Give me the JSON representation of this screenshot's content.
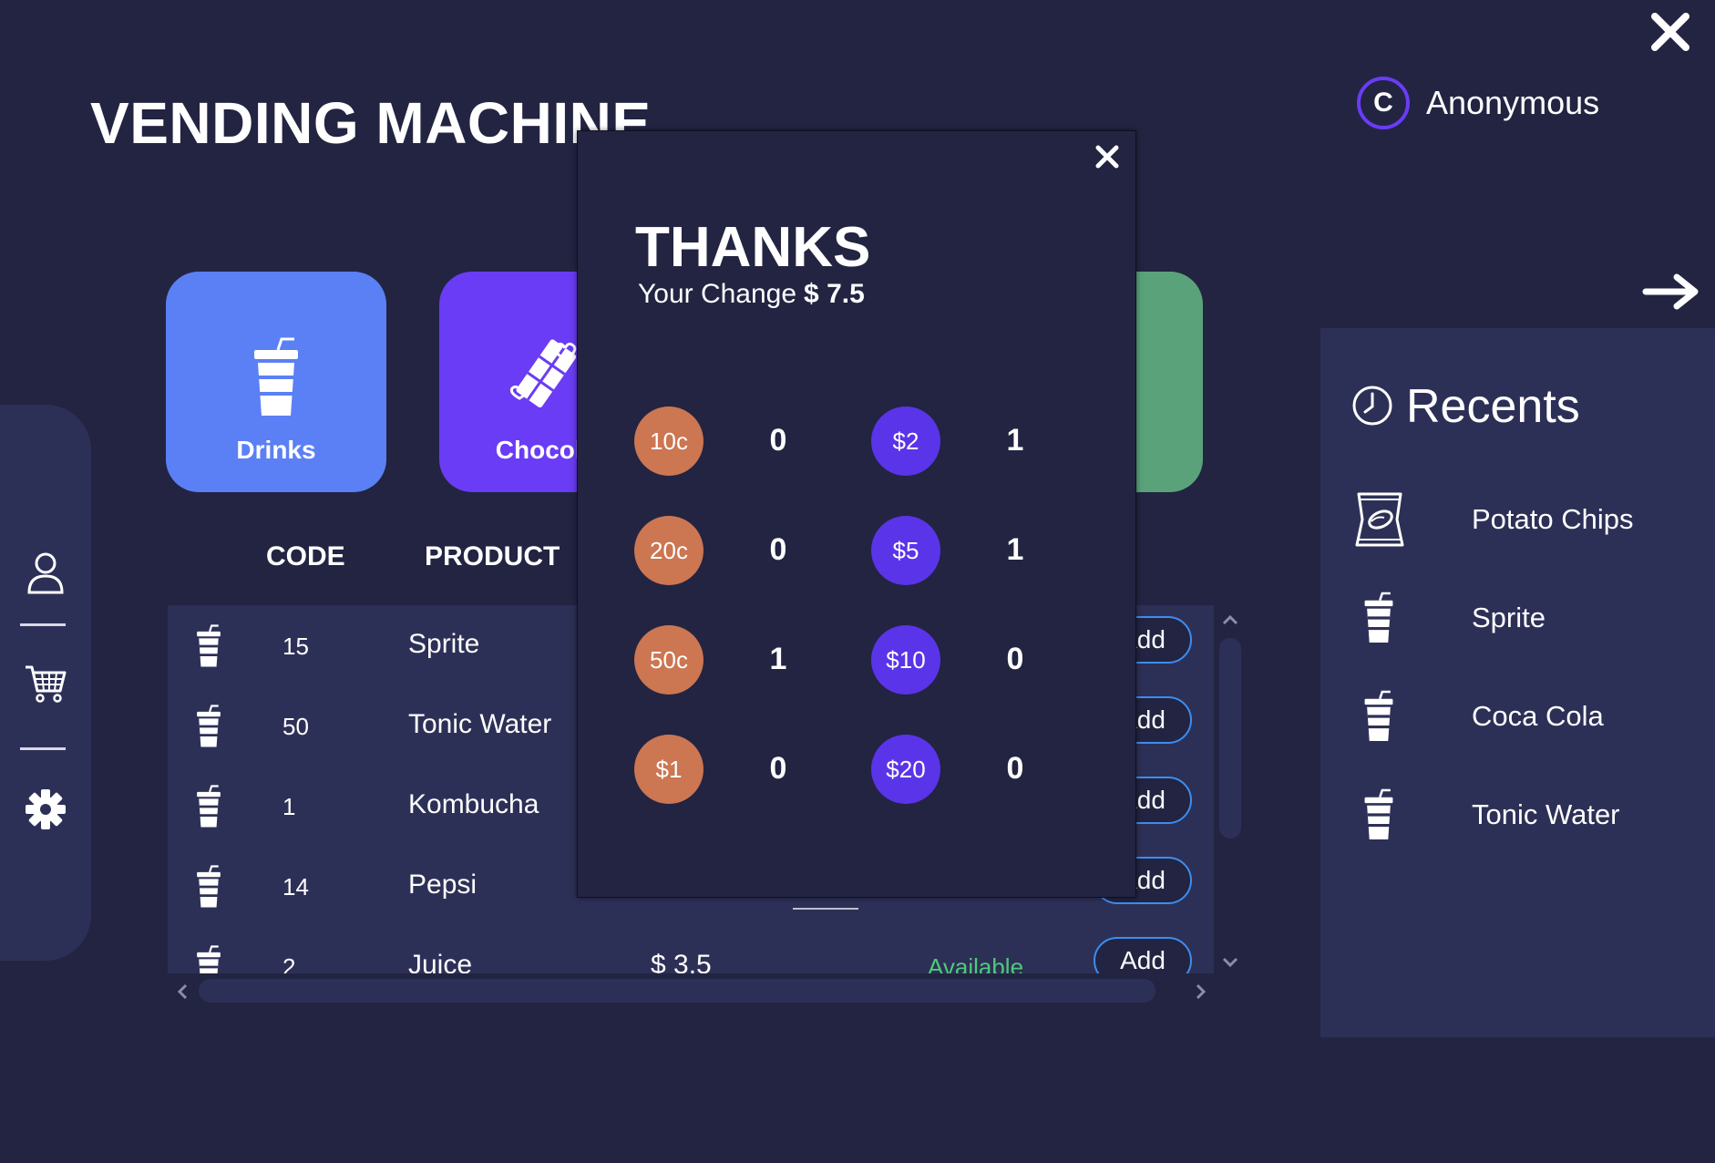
{
  "app": {
    "title": "VENDING MACHINE"
  },
  "user": {
    "initial": "C",
    "name": "Anonymous"
  },
  "categories": [
    {
      "label": "Drinks",
      "color": "#5b80f5",
      "icon": "cup-icon"
    },
    {
      "label": "Chocola",
      "color": "#6a3cf5",
      "icon": "chocolate-icon"
    },
    {
      "label": "",
      "color": "#5aa37a",
      "icon": ""
    }
  ],
  "table": {
    "headers": {
      "code": "CODE",
      "product": "PRODUCT"
    },
    "rows": [
      {
        "code": "15",
        "name": "Sprite",
        "price": "",
        "status": "",
        "action": "Add"
      },
      {
        "code": "50",
        "name": "Tonic Water",
        "price": "",
        "status": "",
        "action": "Add"
      },
      {
        "code": "1",
        "name": "Kombucha",
        "price": "",
        "status": "",
        "action": "Add"
      },
      {
        "code": "14",
        "name": "Pepsi",
        "price": "",
        "status": "",
        "action": "Add"
      },
      {
        "code": "2",
        "name": "Juice",
        "price": "$ 3.5",
        "status": "Available",
        "action": "Add"
      }
    ]
  },
  "recents": {
    "title": "Recents",
    "items": [
      {
        "label": "Potato Chips",
        "icon": "chips-bag-icon"
      },
      {
        "label": "Sprite",
        "icon": "cup-icon"
      },
      {
        "label": "Coca Cola",
        "icon": "cup-icon"
      },
      {
        "label": "Tonic Water",
        "icon": "cup-icon"
      }
    ]
  },
  "modal": {
    "title": "THANKS",
    "change_label": "Your Change",
    "change_amount": "$ 7.5",
    "coins": [
      {
        "label": "10c",
        "qty": "0"
      },
      {
        "label": "20c",
        "qty": "0"
      },
      {
        "label": "50c",
        "qty": "1"
      },
      {
        "label": "$1",
        "qty": "0"
      }
    ],
    "notes": [
      {
        "label": "$2",
        "qty": "1"
      },
      {
        "label": "$5",
        "qty": "1"
      },
      {
        "label": "$10",
        "qty": "0"
      },
      {
        "label": "$20",
        "qty": "0"
      }
    ]
  },
  "colors": {
    "background": "#222442",
    "panel": "#2d3056",
    "coin": "#cc7652",
    "note": "#5a34e8",
    "available": "#4ec97a",
    "add_border": "#3d8df0"
  }
}
